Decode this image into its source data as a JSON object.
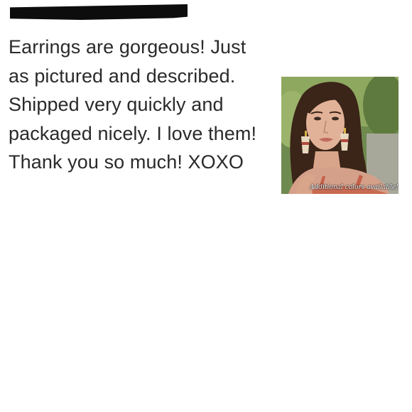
{
  "review": {
    "body": "Earrings are gorgeous! Just as pictured and described. Shipped very quickly and packaged nicely. I love them! Thank you so much! XOXO"
  },
  "product_image": {
    "caption": "Additional colors available!",
    "subject": "model wearing tassel earrings"
  },
  "colors": {
    "text": "#2a2a2a",
    "redaction": "#0d0d0d",
    "background": "#ffffff"
  }
}
